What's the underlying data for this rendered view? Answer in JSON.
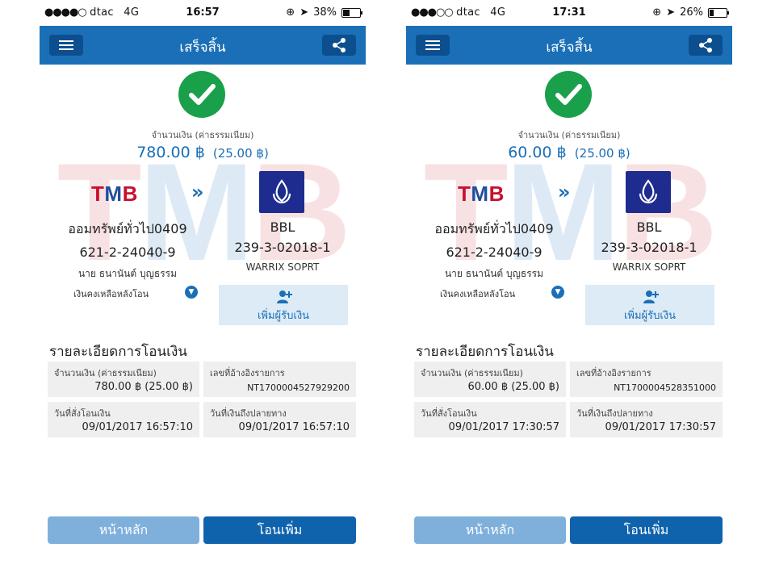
{
  "accent_color": "#1a6fb7",
  "success_color": "#1aa04b",
  "screens": [
    {
      "status": {
        "carrier": "dtac",
        "network": "4G",
        "time": "16:57",
        "battery": "38%",
        "battery_level": 0.38
      },
      "header": {
        "title": "เสร็จสิ้น"
      },
      "amount_label": "จำนวนเงิน (ค่าธรรมเนียม)",
      "amount": "780.00 ฿",
      "fee": "(25.00 ฿)",
      "from": {
        "bank_logo": "TMB",
        "name": "ออมทรัพย์ทั่วไป0409",
        "account": "621-2-24040-9",
        "owner": "นาย ธนานันต์ บุญธรรม"
      },
      "to": {
        "bank_logo_icon": "bbl-lotus-icon",
        "name": "BBL",
        "account": "239-3-02018-1",
        "owner": "WARRIX SOPRT"
      },
      "balance_label": "เงินคงเหลือหลังโอน",
      "add_payee_label": "เพิ่มผู้รับเงิน",
      "details": {
        "title": "รายละเอียดการโอนเงิน",
        "amount_label": "จำนวนเงิน (ค่าธรรมเนียม)",
        "amount_value": "780.00 ฿ (25.00 ฿)",
        "ref_label": "เลขที่อ้างอิงรายการ",
        "ref_value": "NT1700004527929200",
        "order_date_label": "วันที่สั่งโอนเงิน",
        "order_date_value": "09/01/2017 16:57:10",
        "arrive_date_label": "วันที่เงินถึงปลายทาง",
        "arrive_date_value": "09/01/2017 16:57:10"
      },
      "buttons": {
        "home": "หน้าหลัก",
        "again": "โอนเพิ่ม"
      }
    },
    {
      "status": {
        "carrier": "dtac",
        "network": "4G",
        "time": "17:31",
        "battery": "26%",
        "battery_level": 0.26
      },
      "header": {
        "title": "เสร็จสิ้น"
      },
      "amount_label": "จำนวนเงิน (ค่าธรรมเนียม)",
      "amount": "60.00 ฿",
      "fee": "(25.00 ฿)",
      "from": {
        "bank_logo": "TMB",
        "name": "ออมทรัพย์ทั่วไป0409",
        "account": "621-2-24040-9",
        "owner": "นาย ธนานันต์ บุญธรรม"
      },
      "to": {
        "bank_logo_icon": "bbl-lotus-icon",
        "name": "BBL",
        "account": "239-3-02018-1",
        "owner": "WARRIX SOPRT"
      },
      "balance_label": "เงินคงเหลือหลังโอน",
      "add_payee_label": "เพิ่มผู้รับเงิน",
      "details": {
        "title": "รายละเอียดการโอนเงิน",
        "amount_label": "จำนวนเงิน (ค่าธรรมเนียม)",
        "amount_value": "60.00 ฿ (25.00 ฿)",
        "ref_label": "เลขที่อ้างอิงรายการ",
        "ref_value": "NT1700004528351000",
        "order_date_label": "วันที่สั่งโอนเงิน",
        "order_date_value": "09/01/2017 17:30:57",
        "arrive_date_label": "วันที่เงินถึงปลายทาง",
        "arrive_date_value": "09/01/2017 17:30:57"
      },
      "buttons": {
        "home": "หน้าหลัก",
        "again": "โอนเพิ่ม"
      }
    }
  ]
}
